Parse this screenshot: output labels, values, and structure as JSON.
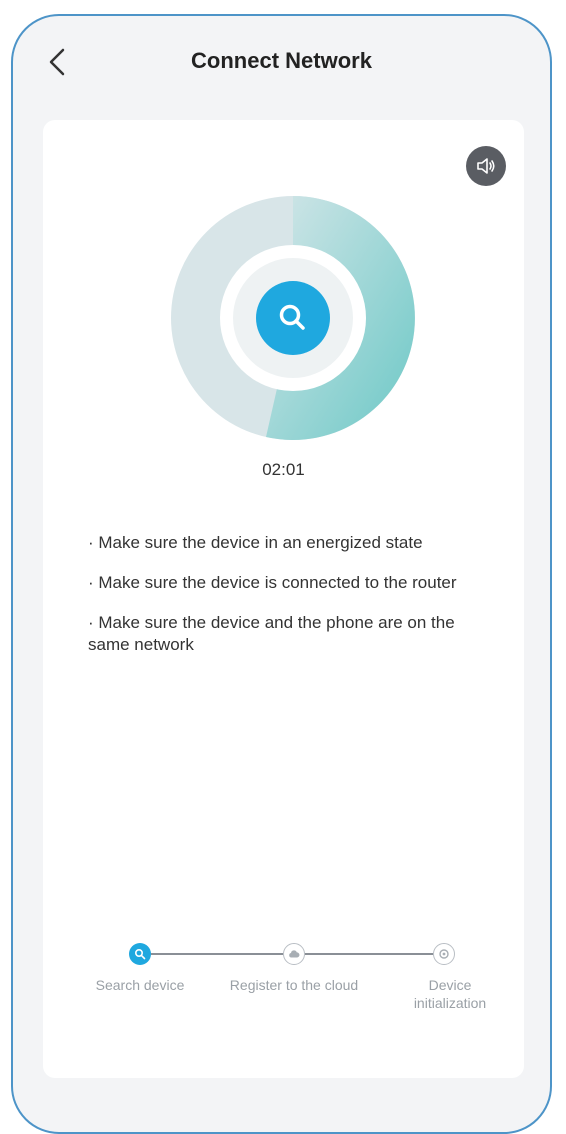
{
  "header": {
    "title": "Connect Network"
  },
  "progress": {
    "timer": "02:01"
  },
  "tips": [
    "· Make sure the device in an energized state",
    "· Make sure the device is connected to the router",
    "· Make sure the device and the phone are on the same network"
  ],
  "steps": [
    {
      "label": "Search device",
      "icon": "search-icon",
      "state": "active"
    },
    {
      "label": "Register to the cloud",
      "icon": "cloud-icon",
      "state": "pending"
    },
    {
      "label": "Device initialization",
      "icon": "initialization-icon",
      "state": "pending"
    }
  ],
  "colors": {
    "accent": "#1fa8df",
    "teal": "#7ccdcd",
    "ring_track": "#d7e4e6",
    "card": "#ffffff",
    "background": "#f3f4f6",
    "frame": "#4d94c8",
    "sound_button": "#5a5d63"
  }
}
